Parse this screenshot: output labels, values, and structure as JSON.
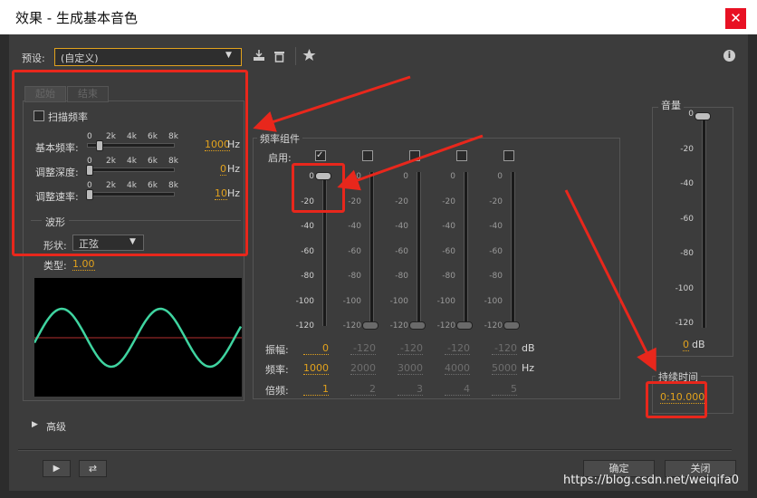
{
  "window": {
    "title": "效果 - 生成基本音色",
    "close_glyph": "✕"
  },
  "preset": {
    "label": "预设:",
    "value": "(自定义)"
  },
  "tabs": [
    "起始",
    "结束"
  ],
  "sweep": {
    "label": "扫描频率"
  },
  "slider_ticks": [
    "0",
    "2k",
    "4k",
    "6k",
    "8k"
  ],
  "sliders": [
    {
      "label": "基本频率:",
      "value": "1000",
      "unit": "Hz"
    },
    {
      "label": "调整深度:",
      "value": "0",
      "unit": "Hz"
    },
    {
      "label": "调整速率:",
      "value": "10",
      "unit": "Hz"
    }
  ],
  "waveform": {
    "group_label": "波形",
    "shape_label": "形状:",
    "shape_value": "正弦",
    "type_label": "类型:",
    "type_value": "1.00"
  },
  "freq_components": {
    "group_label": "频率组件",
    "enable_label": "启用:",
    "db_ticks": [
      "0",
      "-20",
      "-40",
      "-60",
      "-80",
      "-100",
      "-120"
    ],
    "amp_label": "振幅:",
    "amp_unit": "dB",
    "freq_label": "频率:",
    "freq_unit": "Hz",
    "mult_label": "倍频:",
    "channels": [
      {
        "enabled": true,
        "amplitude": "0",
        "frequency": "1000",
        "multiplier": "1"
      },
      {
        "enabled": false,
        "amplitude": "-120",
        "frequency": "2000",
        "multiplier": "2"
      },
      {
        "enabled": false,
        "amplitude": "-120",
        "frequency": "3000",
        "multiplier": "3"
      },
      {
        "enabled": false,
        "amplitude": "-120",
        "frequency": "4000",
        "multiplier": "4"
      },
      {
        "enabled": false,
        "amplitude": "-120",
        "frequency": "5000",
        "multiplier": "5"
      }
    ],
    "check_glyph": "✓"
  },
  "volume": {
    "label": "音量",
    "value": "0",
    "unit": "dB",
    "ticks": [
      "0",
      "-20",
      "-40",
      "-60",
      "-80",
      "-100",
      "-120"
    ]
  },
  "duration": {
    "label": "持续时间",
    "value": "0:10.000"
  },
  "advanced": {
    "label": "高级",
    "arrow": "▶"
  },
  "footer": {
    "ok": "确定",
    "close": "关闭",
    "play_glyph": "▶",
    "loop_glyph": "⇄"
  },
  "watermark": "https://blog.csdn.net/weiqifa0",
  "icons": [
    "save-preset-icon",
    "delete-preset-icon",
    "favorite-star-icon",
    "info-icon"
  ],
  "colors": {
    "accent": "#e2a21d",
    "annotation_red": "#e8271c",
    "wave": "#3fd4a0"
  }
}
